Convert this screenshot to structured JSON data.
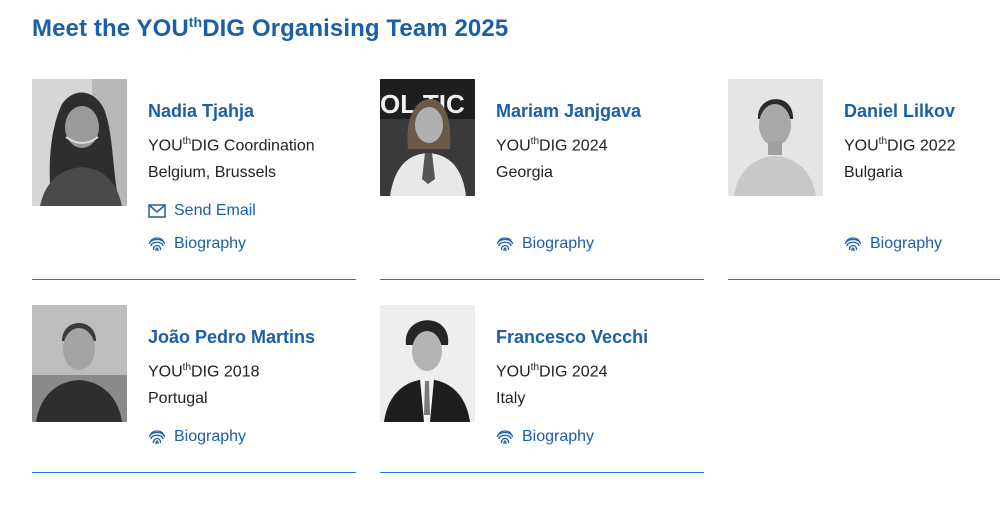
{
  "header": {
    "pre": "Meet the YOU",
    "sup": "th",
    "post": "DIG Organising Team 2025"
  },
  "brand_color": "#1a5fa8",
  "labels": {
    "send_email": "Send Email",
    "biography": "Biography"
  },
  "members": [
    {
      "name": "Nadia Tjahja",
      "role_pre": "YOU",
      "role_sup": "th",
      "role_post": "DIG Coordination",
      "location": "Belgium, Brussels"
    },
    {
      "name": "Mariam Janjgava",
      "role_pre": "YOU",
      "role_sup": "th",
      "role_post": "DIG 2024",
      "location": "Georgia"
    },
    {
      "name": "Daniel Lilkov",
      "role_pre": "YOU",
      "role_sup": "th",
      "role_post": "DIG 2022",
      "location": "Bulgaria"
    },
    {
      "name": "João Pedro Martins",
      "role_pre": "YOU",
      "role_sup": "th",
      "role_post": "DIG 2018",
      "location": "Portugal"
    },
    {
      "name": "Francesco Vecchi",
      "role_pre": "YOU",
      "role_sup": "th",
      "role_post": "DIG 2024",
      "location": "Italy"
    }
  ]
}
